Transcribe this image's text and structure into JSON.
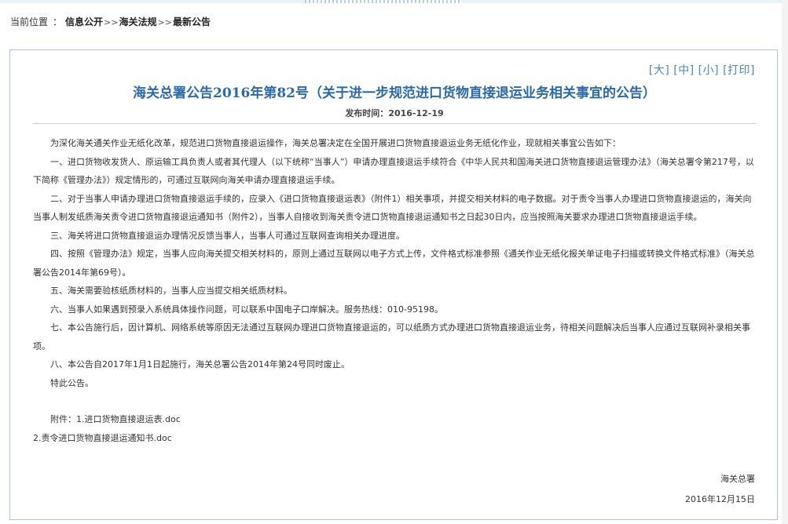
{
  "breadcrumb": {
    "label": "当前位置",
    "colon": "：",
    "items": [
      "信息公开",
      "海关法规",
      "最新公告"
    ],
    "arrow": ">>"
  },
  "tools": {
    "large": "[大]",
    "medium": "[中]",
    "small": "[小]",
    "print": "[打印]"
  },
  "article": {
    "title": "海关总署公告2016年第82号（关于进一步规范进口货物直接退运业务相关事宜的公告）",
    "publish_label": "发布时间：",
    "publish_date": "2016-12-19",
    "paragraphs": [
      "为深化海关通关作业无纸化改革，规范进口货物直接退运操作，海关总署决定在全国开展进口货物直接退运业务无纸化作业，现就相关事宜公告如下：",
      "一、进口货物收发货人、原运输工具负责人或者其代理人（以下统称“当事人”）申请办理直接退运手续符合《中华人民共和国海关进口货物直接退运管理办法》（海关总署令第217号，以下简称《管理办法》）规定情形的，可通过互联网向海关申请办理直接退运手续。",
      "二、对于当事人申请办理进口货物直接退运手续的，应录入《进口货物直接退运表》（附件1）相关事项，并提交相关材料的电子数据。对于责令当事人办理进口货物直接退运的，海关向当事人制发纸质海关责令进口货物直接退运通知书（附件2），当事人自接收到海关责令进口货物直接退运通知书之日起30日内，应当按照海关要求办理进口货物直接退运手续。",
      "三、海关将进口货物直接退运办理情况反馈当事人，当事人可通过互联网查询相关办理进度。",
      "四、按照《管理办法》规定，当事人应向海关提交相关材料的，原则上通过互联网以电子方式上传，文件格式标准参照《通关作业无纸化报关单证电子扫描或转换文件格式标准》（海关总署公告2014年第69号）。",
      "五、海关需要验核纸质材料的，当事人应当提交相关纸质材料。",
      "六、当事人如果遇到预录入系统具体操作问题，可以联系中国电子口岸解决。服务热线：010-95198。",
      "七、本公告施行后，因计算机、网络系统等原因无法通过互联网办理进口货物直接退运的，可以纸质方式办理进口货物直接退运业务，待相关问题解决后当事人应通过互联网补录相关事项。",
      "八、本公告自2017年1月1日起施行，海关总署公告2014年第24号同时废止。",
      "特此公告。"
    ],
    "attachments_label": "附件：",
    "attachments": [
      "1.进口货物直接退运表.doc",
      "2.责令进口货物直接退运通知书.doc"
    ],
    "signer": "海关总署",
    "sign_date": "2016年12月15日"
  },
  "colors": {
    "title": "#2b6aa8",
    "tools": "#4d86c4",
    "border": "#a9c4de"
  }
}
